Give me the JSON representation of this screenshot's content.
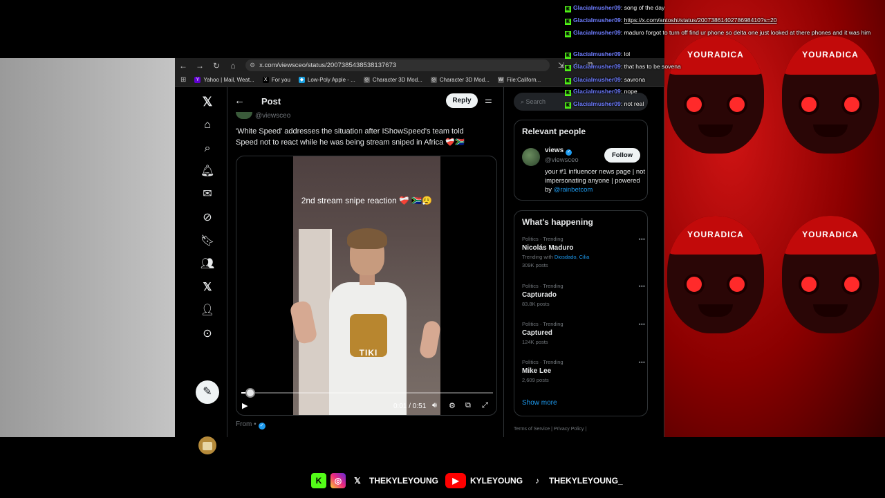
{
  "browser": {
    "url": "x.com/viewsceo/status/2007385438538137673",
    "bookmarks": [
      {
        "label": "Yahoo | Mail, Weat...",
        "color": "#6001d2",
        "glyph": "Y"
      },
      {
        "label": "For you",
        "color": "#000000",
        "glyph": "X"
      },
      {
        "label": "Low-Poly Apple - ...",
        "color": "#1ba1e2",
        "glyph": "◆"
      },
      {
        "label": "Character 3D Mod...",
        "color": "#555555",
        "glyph": "◎"
      },
      {
        "label": "Character 3D Mod...",
        "color": "#555555",
        "glyph": "◎"
      },
      {
        "label": "File:Californ...",
        "color": "#555555",
        "glyph": "W"
      }
    ]
  },
  "x_nav": {
    "icons": [
      "x-logo-icon",
      "home-icon",
      "search-icon",
      "bell-icon",
      "mail-icon",
      "grok-icon",
      "bookmark-icon",
      "communities-icon",
      "premium-x-icon",
      "profile-icon",
      "more-icon"
    ],
    "post_button_icon": "feather-icon"
  },
  "post": {
    "header_title": "Post",
    "reply_label": "Reply",
    "handle": "@viewsceo",
    "text": "'White Speed' addresses the situation after IShowSpeed's team told Speed not to react while he was being stream sniped in Africa ❤️‍🩹🇿🇦",
    "video_caption": "2nd stream snipe reaction ❤️‍🩹 🇿🇦😮‍💨",
    "shirt_text": "TIKI",
    "time": "0:01 / 0:51",
    "progress": 0.02,
    "from_label": "From •"
  },
  "sidebar": {
    "search_placeholder": "Search",
    "relevant": {
      "title": "Relevant people",
      "name": "views",
      "handle": "@viewsceo",
      "follow_label": "Follow",
      "bio": "your #1 influencer news page | not impersonating anyone | powered by ",
      "bio_link": "@rainbetcom"
    },
    "happening": {
      "title": "What's happening",
      "trends": [
        {
          "meta": "Politics · Trending",
          "name": "Nicolás Maduro",
          "sub_prefix": "Trending with ",
          "sub_links": "Diosdado, Cilia",
          "posts": "309K posts"
        },
        {
          "meta": "Politics · Trending",
          "name": "Capturado",
          "sub_prefix": "",
          "sub_links": "",
          "posts": "83.8K posts"
        },
        {
          "meta": "Politics · Trending",
          "name": "Captured",
          "sub_prefix": "",
          "sub_links": "",
          "posts": "124K posts"
        },
        {
          "meta": "Politics · Trending",
          "name": "Mike Lee",
          "sub_prefix": "",
          "sub_links": "",
          "posts": "2,609 posts"
        }
      ],
      "show_more": "Show more"
    },
    "footer": "Terms of Service  |  Privacy Policy  |"
  },
  "chat": [
    {
      "user": "Glacialmusher09",
      "msg": "song of the day",
      "link": false
    },
    {
      "user": "Glacialmusher09",
      "msg": "https://x.com/antoshi/status/2007386140278698410?s=20",
      "link": true
    },
    {
      "user": "Glacialmusher09",
      "msg": "maduro forgot to turn off find ur phone so delta one just looked at there phones and it was him",
      "link": false
    },
    {
      "user": "Glacialmusher09",
      "msg": "lol",
      "link": false
    },
    {
      "user": "Glacialmusher09",
      "msg": "that has to be sovena",
      "link": false
    },
    {
      "user": "Glacialmusher09",
      "msg": "savrona",
      "link": false
    },
    {
      "user": "Glacialmusher09",
      "msg": "nope",
      "link": false
    },
    {
      "user": "Glacialmusher09",
      "msg": "not real",
      "link": false
    }
  ],
  "stream_art": {
    "cap_text": "YOURADICA"
  },
  "socials": [
    {
      "icon": "kick-icon",
      "label": ""
    },
    {
      "icon": "instagram-icon",
      "label": ""
    },
    {
      "icon": "x-icon",
      "label": "THEKYLEYOUNG"
    },
    {
      "icon": "youtube-icon",
      "label": "KYLEYOUNG"
    },
    {
      "icon": "tiktok-icon",
      "label": "THEKYLEYOUNG_"
    }
  ]
}
